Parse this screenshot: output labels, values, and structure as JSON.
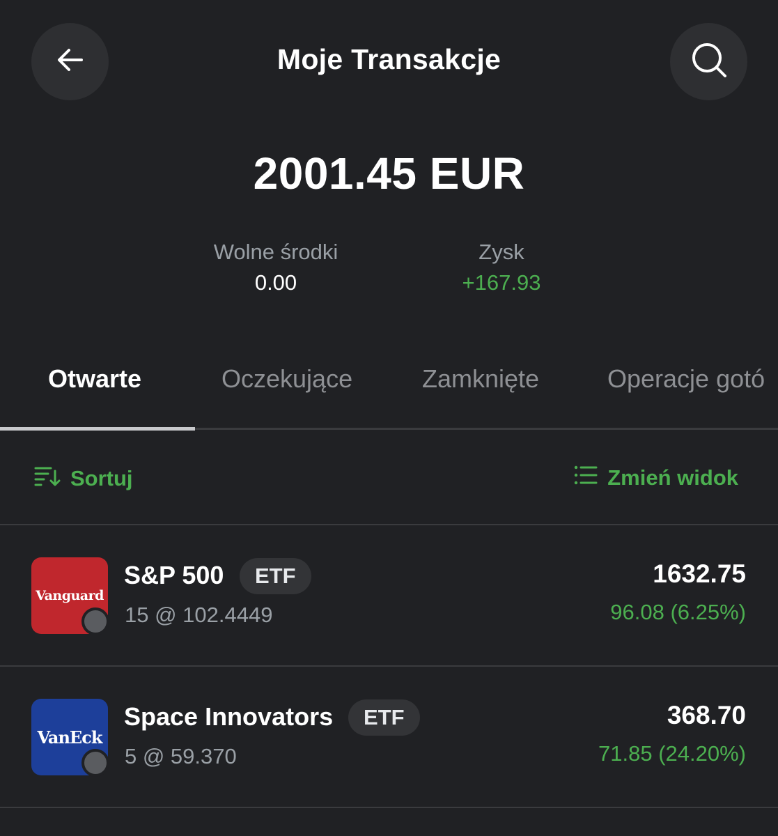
{
  "header": {
    "title": "Moje Transakcje",
    "back_icon": "arrow-left-icon",
    "search_icon": "search-icon"
  },
  "summary": {
    "total": "2001.45 EUR",
    "free_funds_label": "Wolne środki",
    "free_funds_value": "0.00",
    "profit_label": "Zysk",
    "profit_value": "+167.93"
  },
  "tabs": [
    {
      "label": "Otwarte",
      "active": true
    },
    {
      "label": "Oczekujące",
      "active": false
    },
    {
      "label": "Zamknięte",
      "active": false
    },
    {
      "label": "Operacje gotó",
      "active": false
    }
  ],
  "toolbar": {
    "sort_label": "Sortuj",
    "view_label": "Zmień widok"
  },
  "positions": [
    {
      "logo_text": "Vanguard",
      "name": "S&P 500",
      "badge": "ETF",
      "qty": "15 @ 102.4449",
      "amount": "1632.75",
      "change": "96.08 (6.25%)"
    },
    {
      "logo_text": "VanEck",
      "name": "Space Innovators",
      "badge": "ETF",
      "qty": "5 @ 59.370",
      "amount": "368.70",
      "change": "71.85 (24.20%)"
    }
  ],
  "colors": {
    "background": "#202124",
    "positive": "#4caf50",
    "vanguard_red": "#c0272d",
    "vaneck_blue": "#1d3f9a"
  }
}
